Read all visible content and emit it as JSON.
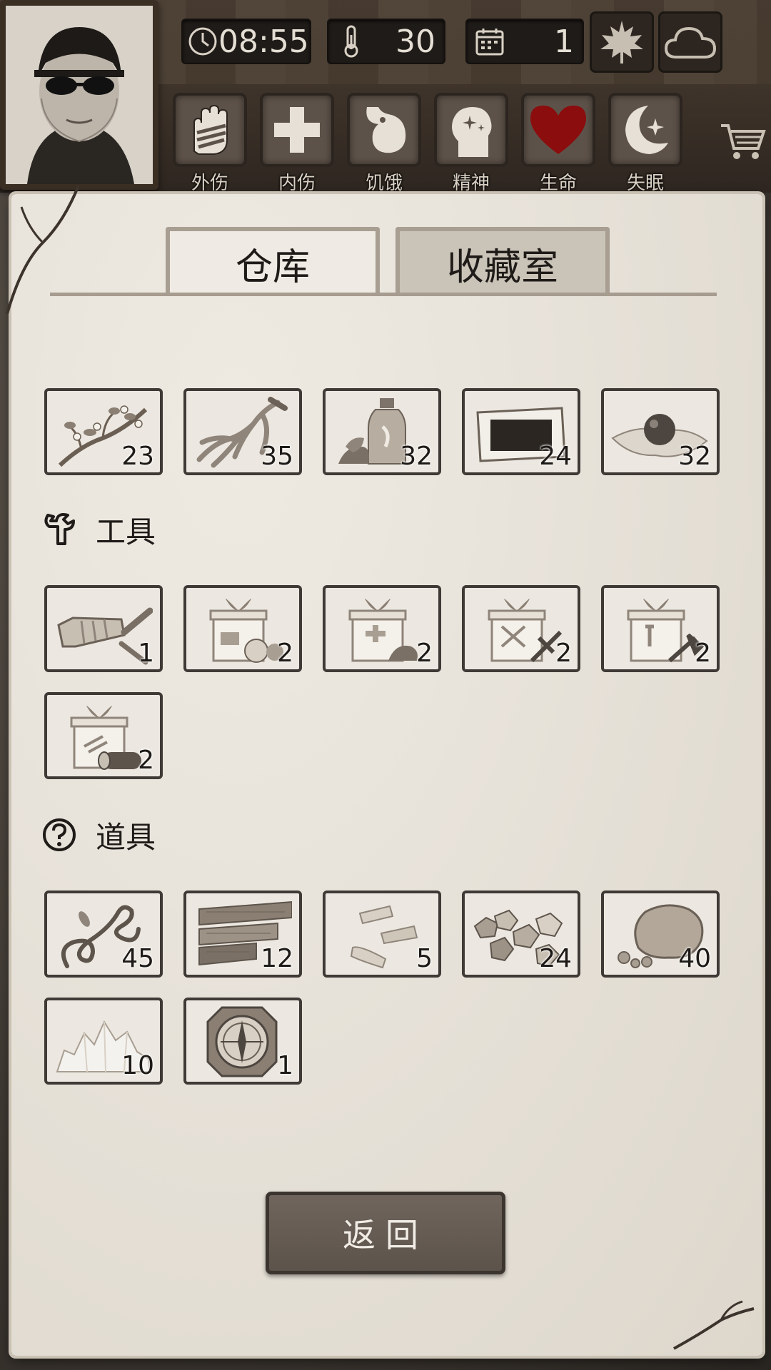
{
  "hud": {
    "time": "08:55",
    "temperature": "30",
    "day": "1",
    "icons": {
      "clock": "clock-icon",
      "thermometer": "thermometer-icon",
      "calendar": "calendar-icon",
      "season": "maple-leaf-icon",
      "weather": "cloud-icon",
      "shop": "cart-icon"
    }
  },
  "status": [
    {
      "label": "外伤",
      "icon": "hand-bandage-icon"
    },
    {
      "label": "内伤",
      "icon": "cross-icon"
    },
    {
      "label": "饥饿",
      "icon": "stomach-icon"
    },
    {
      "label": "精神",
      "icon": "head-sparkle-icon"
    },
    {
      "label": "生命",
      "icon": "heart-icon",
      "color": "#8b0d0d"
    },
    {
      "label": "失眠",
      "icon": "moon-star-icon"
    }
  ],
  "tabs": {
    "warehouse": "仓库",
    "collection": "收藏室"
  },
  "sections": {
    "tools": "工具",
    "props": "道具"
  },
  "items": {
    "herbs": [
      {
        "name": "flower-branch",
        "count": "23"
      },
      {
        "name": "ginseng-root",
        "count": "35"
      },
      {
        "name": "herb-bottle",
        "count": "32"
      },
      {
        "name": "black-plaster",
        "count": "24"
      },
      {
        "name": "pill-on-paper",
        "count": "32"
      }
    ],
    "tools": [
      {
        "name": "flashlight",
        "count": "1"
      },
      {
        "name": "food-gift-box",
        "count": "2"
      },
      {
        "name": "medical-gift-box",
        "count": "2"
      },
      {
        "name": "weapon-gift-box",
        "count": "2"
      },
      {
        "name": "tool-gift-box",
        "count": "2"
      },
      {
        "name": "wood-gift-box",
        "count": "2"
      }
    ],
    "props": [
      {
        "name": "vine-rope",
        "count": "45"
      },
      {
        "name": "wood-planks",
        "count": "12"
      },
      {
        "name": "bone-pieces",
        "count": "5"
      },
      {
        "name": "ore-nuggets",
        "count": "24"
      },
      {
        "name": "stone-rock",
        "count": "40"
      },
      {
        "name": "salt-crystals",
        "count": "10"
      },
      {
        "name": "compass",
        "count": "1"
      }
    ]
  },
  "buttons": {
    "back": "返回"
  }
}
